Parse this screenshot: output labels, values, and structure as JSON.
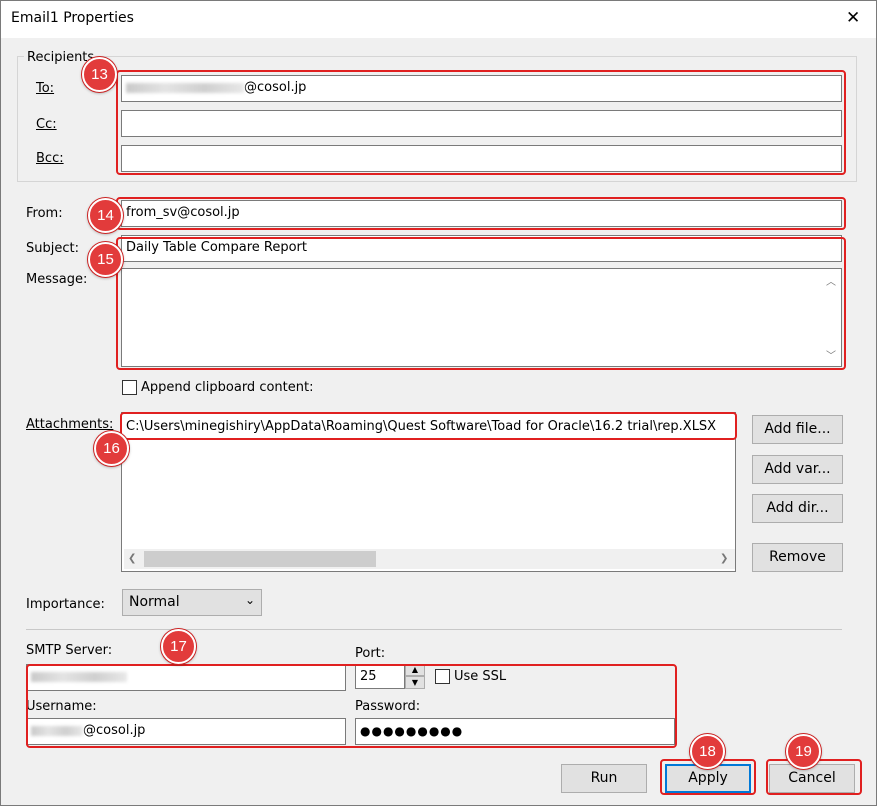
{
  "window": {
    "title": "Email1 Properties",
    "close_glyph": "✕"
  },
  "recipients": {
    "group_title": "Recipients",
    "to_label": "To:",
    "to_value_suffix": "@cosol.jp",
    "cc_label": "Cc:",
    "cc_value": "",
    "bcc_label": "Bcc:",
    "bcc_value": ""
  },
  "from": {
    "label": "From:",
    "value": "from_sv@cosol.jp"
  },
  "subject": {
    "label": "Subject:",
    "value": "Daily Table Compare Report"
  },
  "message": {
    "label": "Message:",
    "value": ""
  },
  "append_clipboard": {
    "label": "Append clipboard content:",
    "checked": false
  },
  "attachments": {
    "label": "Attachments:",
    "items": [
      "C:\\Users\\minegishiry\\AppData\\Roaming\\Quest Software\\Toad for Oracle\\16.2 trial\\rep.XLSX"
    ],
    "buttons": {
      "add_file": "Add file...",
      "add_var": "Add var...",
      "add_dir": "Add dir...",
      "remove": "Remove"
    }
  },
  "importance": {
    "label": "Importance:",
    "value": "Normal"
  },
  "smtp": {
    "server_label": "SMTP Server:",
    "port_label": "Port:",
    "port_value": "25",
    "use_ssl_label": "Use SSL",
    "use_ssl_checked": false,
    "username_label": "Username:",
    "username_suffix": "@cosol.jp",
    "password_label": "Password:",
    "password_value": "●●●●●●●●●"
  },
  "footer": {
    "run": "Run",
    "apply": "Apply",
    "cancel": "Cancel"
  },
  "annotations": [
    "13",
    "14",
    "15",
    "16",
    "17",
    "18",
    "19"
  ],
  "colors": {
    "annotation_red": "#e23b3b",
    "window_bg": "#f0f0f0",
    "button_bg": "#e1e1e1"
  },
  "icons": {
    "scroll_up": "chevron-up-icon",
    "scroll_down": "chevron-down-icon",
    "scroll_left": "chevron-left-icon",
    "scroll_right": "chevron-right-icon",
    "dropdown": "chevron-down-icon"
  }
}
